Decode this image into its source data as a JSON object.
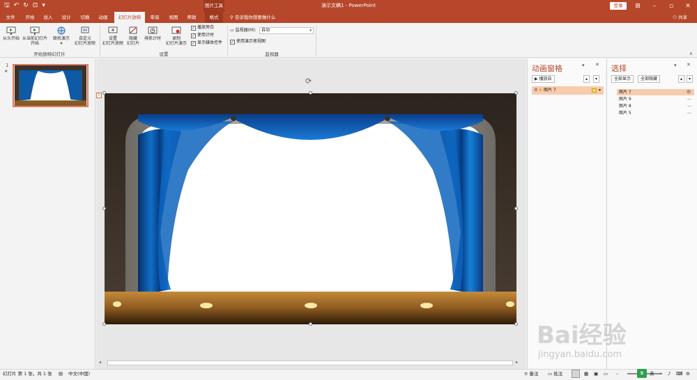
{
  "titlebar": {
    "tool_tab": "图片工具",
    "title": "演示文稿1  -  PowerPoint",
    "login": "登录",
    "colors": {
      "brand": "#b7472a"
    }
  },
  "tabs": [
    {
      "label": "文件",
      "left": 0
    },
    {
      "label": "开始"
    },
    {
      "label": "插入"
    },
    {
      "label": "设计"
    },
    {
      "label": "切换"
    },
    {
      "label": "动画"
    },
    {
      "label": "幻灯片放映"
    },
    {
      "label": "审阅"
    },
    {
      "label": "视图"
    },
    {
      "label": "帮助"
    },
    {
      "label": "格式"
    }
  ],
  "tellme": "告诉我你想要做什么",
  "share": "共享",
  "ribbon": {
    "start_group": {
      "from_beginning": "从头开始",
      "from_current_1": "从当前幻灯片",
      "from_current_2": "开始",
      "online": "联机演示",
      "custom_1": "自定义",
      "custom_2": "幻灯片放映",
      "label": "开始放映幻灯片"
    },
    "setup_group": {
      "setup_1": "设置",
      "setup_2": "幻灯片放映",
      "hide_1": "隐藏",
      "hide_2": "幻灯片",
      "rehearse": "排练计时",
      "record_1": "录制",
      "record_2": "幻灯片演示",
      "chk_narration": "播放旁白",
      "chk_timing": "使用计时",
      "chk_media": "显示媒体控件",
      "label": "设置"
    },
    "monitor_group": {
      "monitor_label": "监视器(M):",
      "monitor_value": "自动",
      "presenter_view": "使用演示者视图",
      "label": "监视器"
    }
  },
  "thumbs": {
    "slide_number": "1",
    "star": "★"
  },
  "slide": {
    "tag": "0"
  },
  "anim_pane": {
    "title": "动画窗格",
    "play_from": "播放自",
    "item_index": "0",
    "item_label": "图片 7"
  },
  "sel_pane": {
    "title": "选择",
    "show_all": "全部显示",
    "hide_all": "全部隐藏",
    "items": [
      {
        "label": "图片 7",
        "active": true
      },
      {
        "label": "图片 9"
      },
      {
        "label": "图片 8"
      },
      {
        "label": "图片 5"
      }
    ]
  },
  "status": {
    "slide_info": "幻灯片 第 1 张，共 1 张",
    "language": "中文(中国)",
    "notes": "备注",
    "comments": "批注"
  },
  "watermark": {
    "brand": "Bai经验",
    "url": "jingyan.baidu.com",
    "badge": "英"
  }
}
